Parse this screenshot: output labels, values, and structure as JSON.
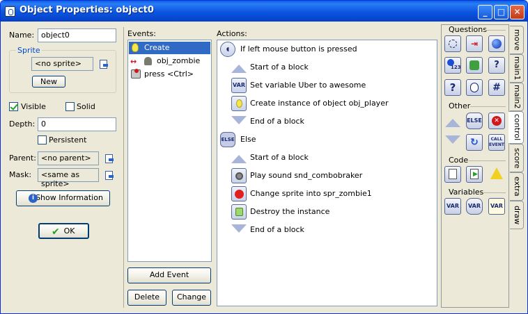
{
  "window": {
    "title": "Object Properties: object0"
  },
  "left": {
    "name_label": "Name:",
    "name_value": "object0",
    "sprite_group": "Sprite",
    "sprite_value": "<no sprite>",
    "new_button": "New",
    "visible_label": "Visible",
    "visible_checked": true,
    "solid_label": "Solid",
    "solid_checked": false,
    "depth_label": "Depth:",
    "depth_value": "0",
    "persistent_label": "Persistent",
    "persistent_checked": false,
    "parent_label": "Parent:",
    "parent_value": "<no parent>",
    "mask_label": "Mask:",
    "mask_value": "<same as sprite>",
    "show_info_button": "Show Information",
    "ok_button": "OK"
  },
  "events": {
    "label": "Events:",
    "items": [
      {
        "label": "Create",
        "icon": "lightbulb-icon",
        "selected": true
      },
      {
        "label": "obj_zombie",
        "icon": "collision-icon",
        "selected": false
      },
      {
        "label": "press <Ctrl>",
        "icon": "keyboard-icon",
        "selected": false
      }
    ],
    "add_button": "Add Event",
    "delete_button": "Delete",
    "change_button": "Change"
  },
  "actions": {
    "label": "Actions:",
    "items": [
      {
        "label": "If left mouse button is pressed",
        "icon": "mouse-icon",
        "indent": 0
      },
      {
        "label": "Start of a block",
        "icon": "block-start-icon",
        "indent": 1
      },
      {
        "label": "Set variable Uber to awesome",
        "icon": "var-icon",
        "indent": 1
      },
      {
        "label": "Create instance of object obj_player",
        "icon": "lightbulb-icon",
        "indent": 1
      },
      {
        "label": "End of a block",
        "icon": "block-end-icon",
        "indent": 1
      },
      {
        "label": "Else",
        "icon": "else-icon",
        "indent": 0
      },
      {
        "label": "Start of a block",
        "icon": "block-start-icon",
        "indent": 1
      },
      {
        "label": "Play sound snd_combobraker",
        "icon": "speaker-icon",
        "indent": 1
      },
      {
        "label": "Change sprite into spr_zombie1",
        "icon": "pacman-icon",
        "indent": 1
      },
      {
        "label": "Destroy the instance",
        "icon": "destroy-icon",
        "indent": 1
      },
      {
        "label": "End of a block",
        "icon": "block-end-icon",
        "indent": 1
      }
    ]
  },
  "palette": {
    "questions_label": "Questions",
    "other_label": "Other",
    "code_label": "Code",
    "variables_label": "Variables",
    "else_text": "ELSE",
    "call_event_text": "CALL EVENT",
    "var_text": "VAR"
  },
  "tabs": [
    "move",
    "main1",
    "main2",
    "control",
    "score",
    "extra",
    "draw"
  ],
  "active_tab": "control"
}
